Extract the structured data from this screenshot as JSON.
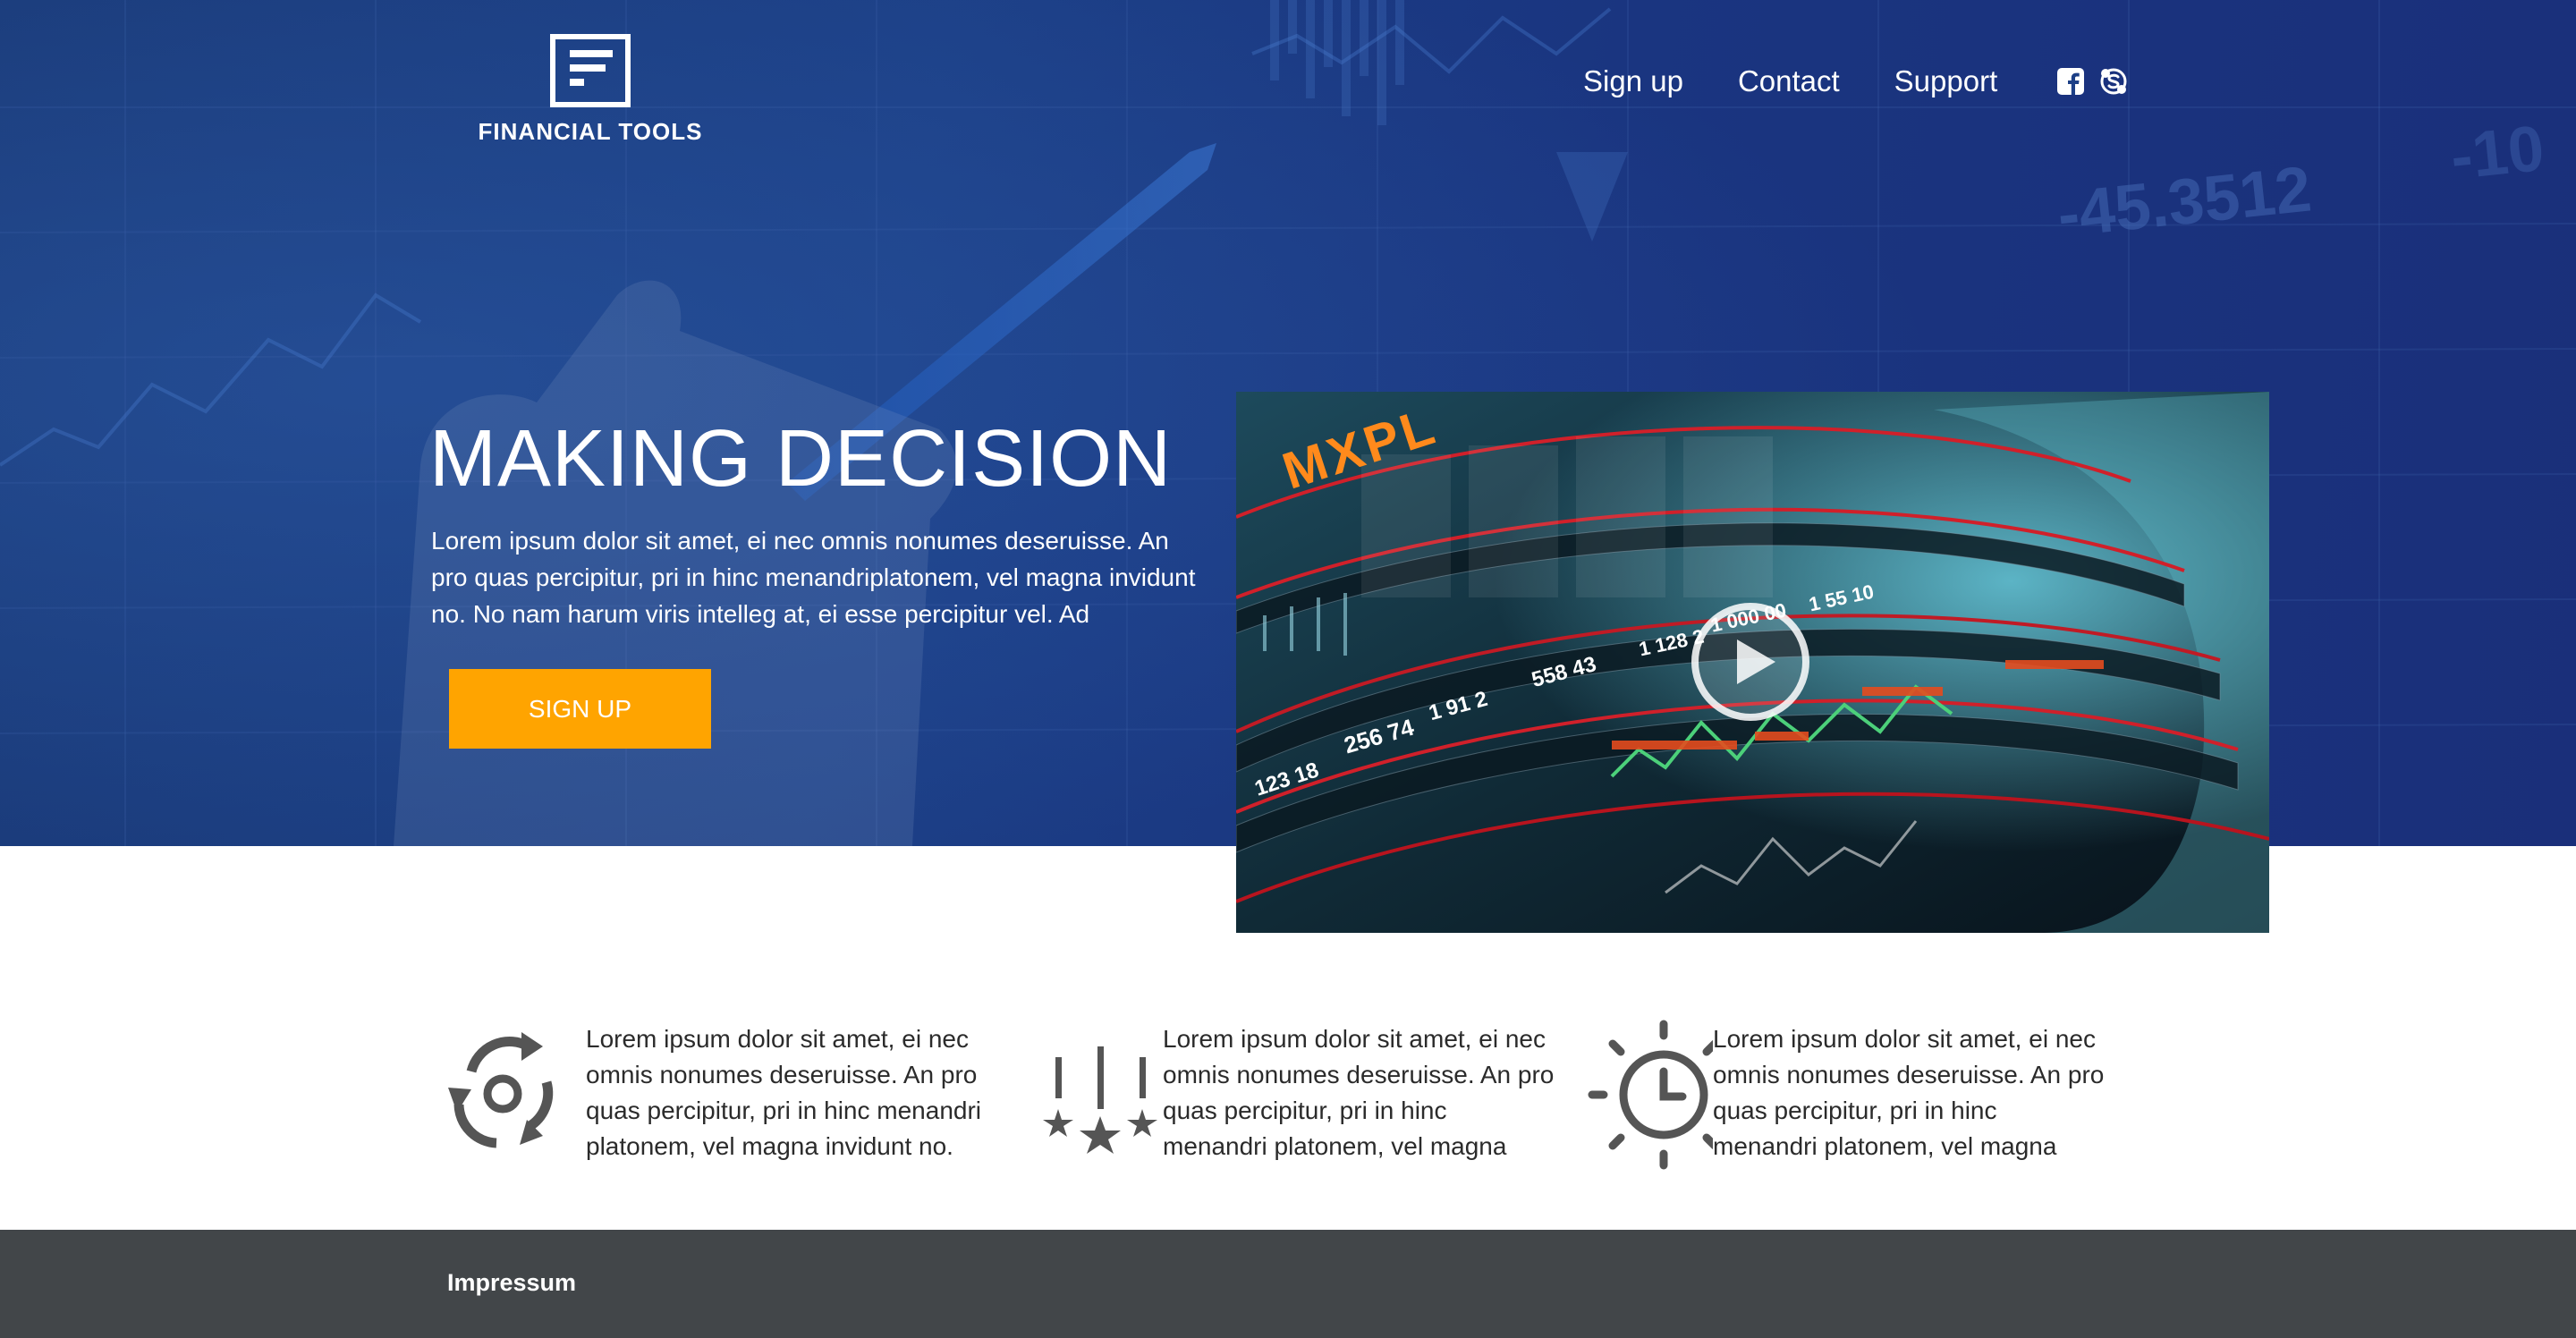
{
  "brand": {
    "name": "FINANCIAL TOOLS",
    "icon": "logo-f-icon"
  },
  "nav": {
    "items": [
      "Sign up",
      "Contact",
      "Support"
    ],
    "social": [
      "facebook-icon",
      "skype-icon"
    ]
  },
  "hero": {
    "title": "MAKING DECISION",
    "text": "Lorem ipsum dolor sit amet, ei nec omnis nonumes deseruisse. An pro quas percipitur, pri in hinc menandriplatonem, vel magna invidunt no. No nam harum viris intelleg at, ei esse percipitur vel. Ad",
    "cta": "SIGN UP",
    "background_overlay_numbers": [
      "-45.3512",
      "-10"
    ],
    "video_overlay_labels": [
      "MXPL",
      "1 55 10",
      "1 000 00",
      "1 128 2",
      "558 43",
      "1 91 2",
      "256 74",
      "123 18"
    ]
  },
  "features": [
    {
      "icon": "refresh-cycle-icon",
      "text": "Lorem ipsum dolor sit amet, ei nec omnis nonumes deseruisse. An pro quas percipitur, pri in hinc menandri platonem, vel magna invidunt no."
    },
    {
      "icon": "falling-stars-icon",
      "text": "Lorem ipsum dolor sit amet, ei nec omnis nonumes deseruisse. An pro quas percipitur, pri in hinc menandri platonem, vel magna"
    },
    {
      "icon": "sun-clock-icon",
      "text": "Lorem ipsum dolor sit amet, ei nec omnis nonumes deseruisse. An pro quas percipitur, pri in hinc menandri platonem, vel magna"
    }
  ],
  "footer": {
    "link": "Impressum"
  },
  "colors": {
    "hero_bg": "#1c3f86",
    "cta": "#ffa400",
    "footer": "#424649",
    "text_dark": "#2b2b2b",
    "icon_gray": "#555555"
  }
}
